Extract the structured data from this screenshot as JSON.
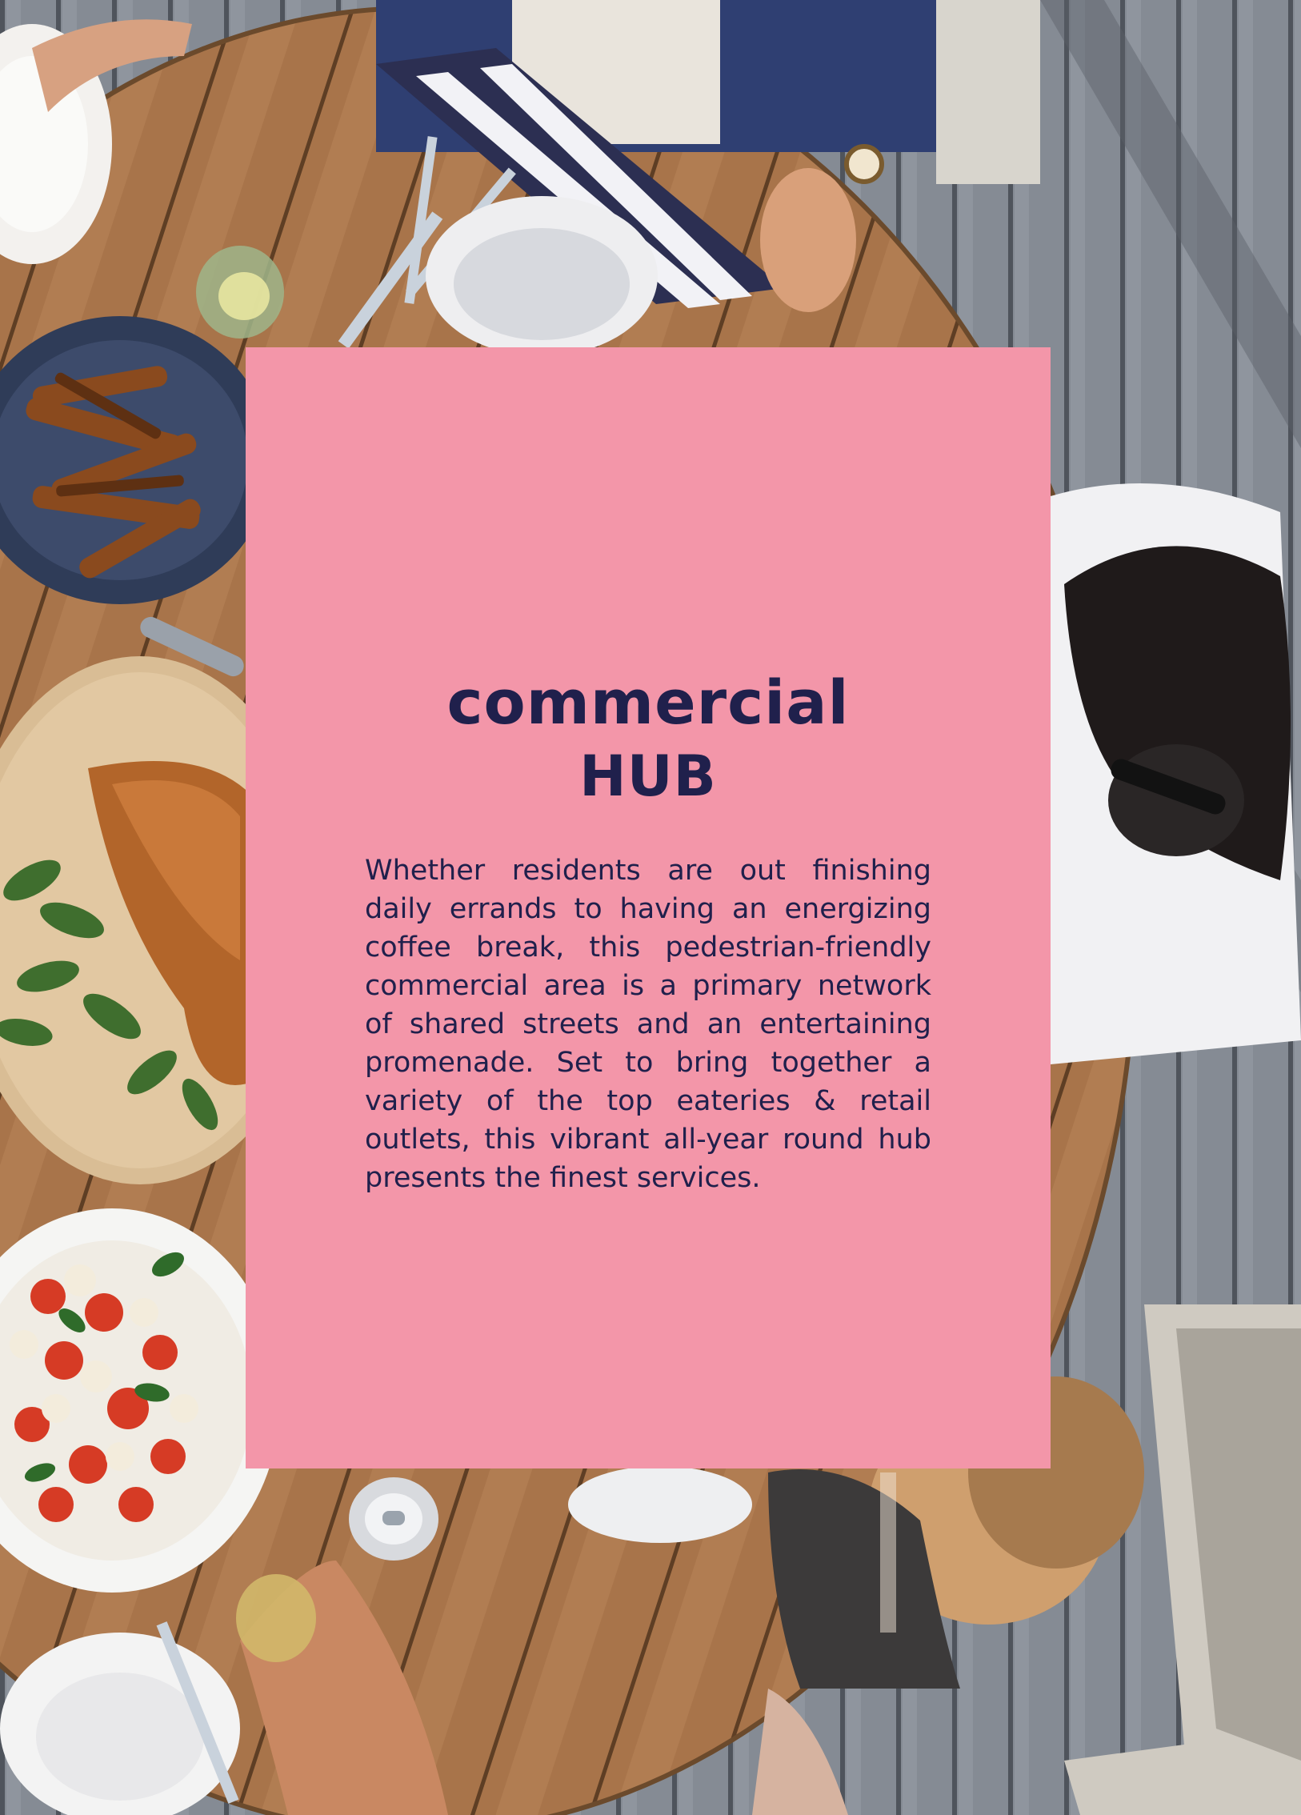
{
  "document": {
    "title_line1": "commercial",
    "title_line2": "HUB",
    "body": "Whether residents are out finishing daily errands to having an energizing coffee break, this pedestrian-friendly commercial area is a primary network of shared streets and an entertaining promenade. Set to bring together a variety of the top eateries & retail outlets, this vibrant all-year round hub presents the finest services."
  },
  "colors": {
    "card": "#f396a9",
    "text": "#20204c",
    "deck": "#7b8089",
    "table": "#a9754a"
  }
}
